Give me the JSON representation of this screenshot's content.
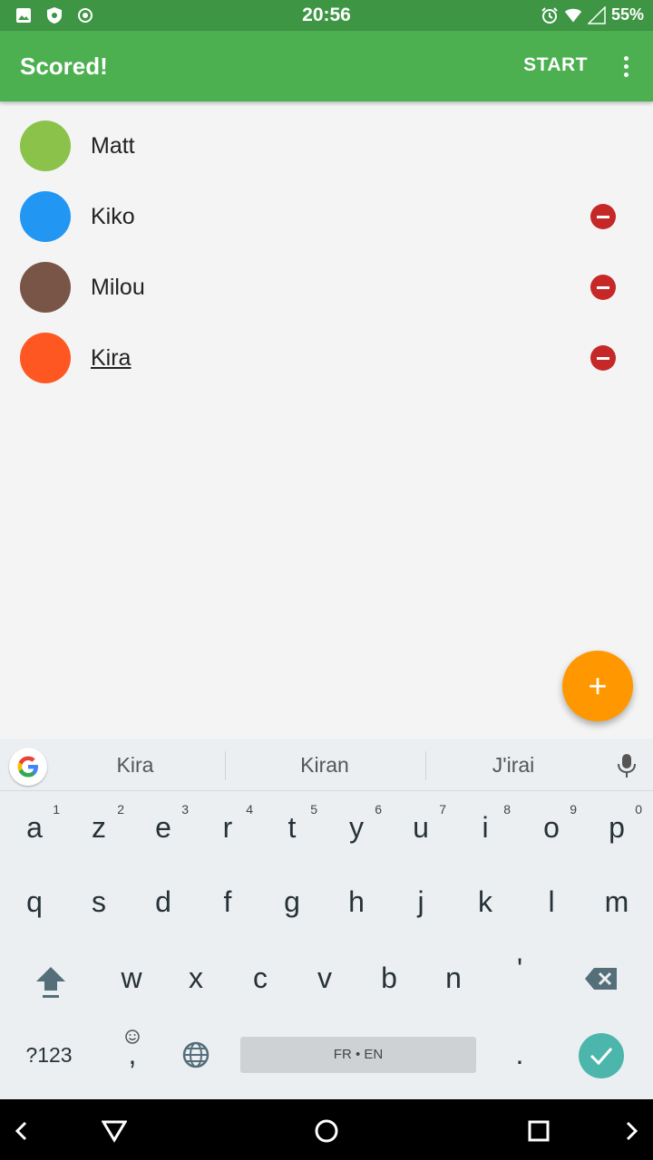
{
  "status_bar": {
    "time": "20:56",
    "battery": "55%"
  },
  "app_bar": {
    "title": "Scored!",
    "start_label": "START"
  },
  "players": [
    {
      "name": "Matt",
      "color": "#8bc34a",
      "removable": false,
      "editing": false
    },
    {
      "name": "Kiko",
      "color": "#2196f3",
      "removable": true,
      "editing": false
    },
    {
      "name": "Milou",
      "color": "#795548",
      "removable": true,
      "editing": false
    },
    {
      "name": "Kira",
      "color": "#ff5722",
      "removable": true,
      "editing": true
    }
  ],
  "fab": {
    "label": "+"
  },
  "keyboard": {
    "suggestions": [
      "Kira",
      "Kiran",
      "J'irai"
    ],
    "row1": [
      {
        "ch": "a",
        "hint": "1"
      },
      {
        "ch": "z",
        "hint": "2"
      },
      {
        "ch": "e",
        "hint": "3"
      },
      {
        "ch": "r",
        "hint": "4"
      },
      {
        "ch": "t",
        "hint": "5"
      },
      {
        "ch": "y",
        "hint": "6"
      },
      {
        "ch": "u",
        "hint": "7"
      },
      {
        "ch": "i",
        "hint": "8"
      },
      {
        "ch": "o",
        "hint": "9"
      },
      {
        "ch": "p",
        "hint": "0"
      }
    ],
    "row2": [
      "q",
      "s",
      "d",
      "f",
      "g",
      "h",
      "j",
      "k",
      "l",
      "m"
    ],
    "row3": [
      "w",
      "x",
      "c",
      "v",
      "b",
      "n",
      "'"
    ],
    "symbols_label": "?123",
    "comma_label": ",",
    "space_label": "FR • EN",
    "period_label": "."
  },
  "colors": {
    "status_bar": "#3e9644",
    "app_bar": "#4caf50",
    "fab": "#ff9800",
    "remove": "#c62828",
    "enter": "#4db6ac"
  }
}
